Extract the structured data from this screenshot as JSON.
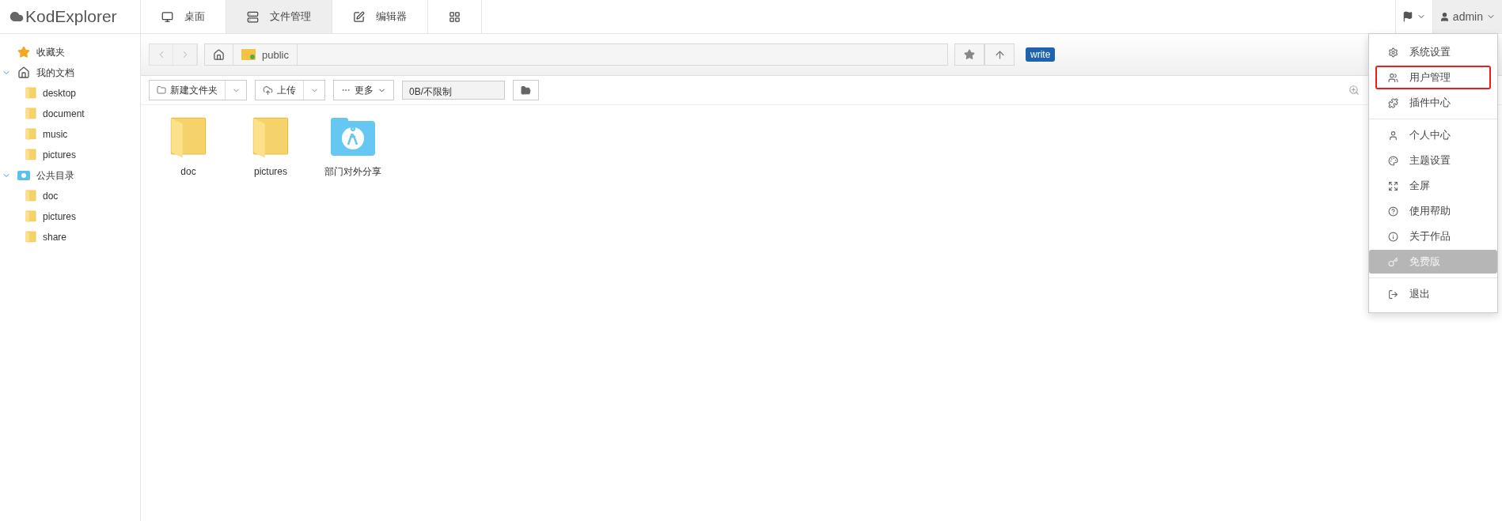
{
  "logo": "KodExplorer",
  "tabs": [
    {
      "label": "桌面",
      "selected": false
    },
    {
      "label": "文件管理",
      "selected": true
    },
    {
      "label": "编辑器",
      "selected": false
    },
    {
      "selected": false
    }
  ],
  "user": {
    "name": "admin"
  },
  "sidebar": [
    {
      "label": "收藏夹"
    },
    {
      "label": "我的文档",
      "expanded": true,
      "children": [
        {
          "label": "desktop"
        },
        {
          "label": "document"
        },
        {
          "label": "music"
        },
        {
          "label": "pictures"
        }
      ]
    },
    {
      "label": "公共目录",
      "expanded": true,
      "children": [
        {
          "label": "doc"
        },
        {
          "label": "pictures"
        },
        {
          "label": "share"
        }
      ]
    }
  ],
  "path": {
    "segment": "public",
    "badge": "write"
  },
  "toolbar": {
    "new_folder": "新建文件夹",
    "upload": "上传",
    "more": "更多",
    "space": "0B/不限制"
  },
  "files": [
    {
      "name": "doc",
      "kind": "folder"
    },
    {
      "name": "pictures",
      "kind": "folder"
    },
    {
      "name": "部门对外分享",
      "kind": "share"
    }
  ],
  "menu": [
    [
      {
        "label": "系统设置",
        "highlighted": false,
        "disabled": false
      },
      {
        "label": "用户管理",
        "highlighted": true,
        "disabled": false
      },
      {
        "label": "插件中心",
        "highlighted": false,
        "disabled": false
      }
    ],
    [
      {
        "label": "个人中心",
        "highlighted": false,
        "disabled": false
      },
      {
        "label": "主题设置",
        "highlighted": false,
        "disabled": false
      },
      {
        "label": "全屏",
        "highlighted": false,
        "disabled": false
      },
      {
        "label": "使用帮助",
        "highlighted": false,
        "disabled": false
      },
      {
        "label": "关于作品",
        "highlighted": false,
        "disabled": false
      },
      {
        "label": "免费版",
        "highlighted": false,
        "disabled": true
      }
    ],
    [
      {
        "label": "退出",
        "highlighted": false,
        "disabled": false
      }
    ]
  ]
}
